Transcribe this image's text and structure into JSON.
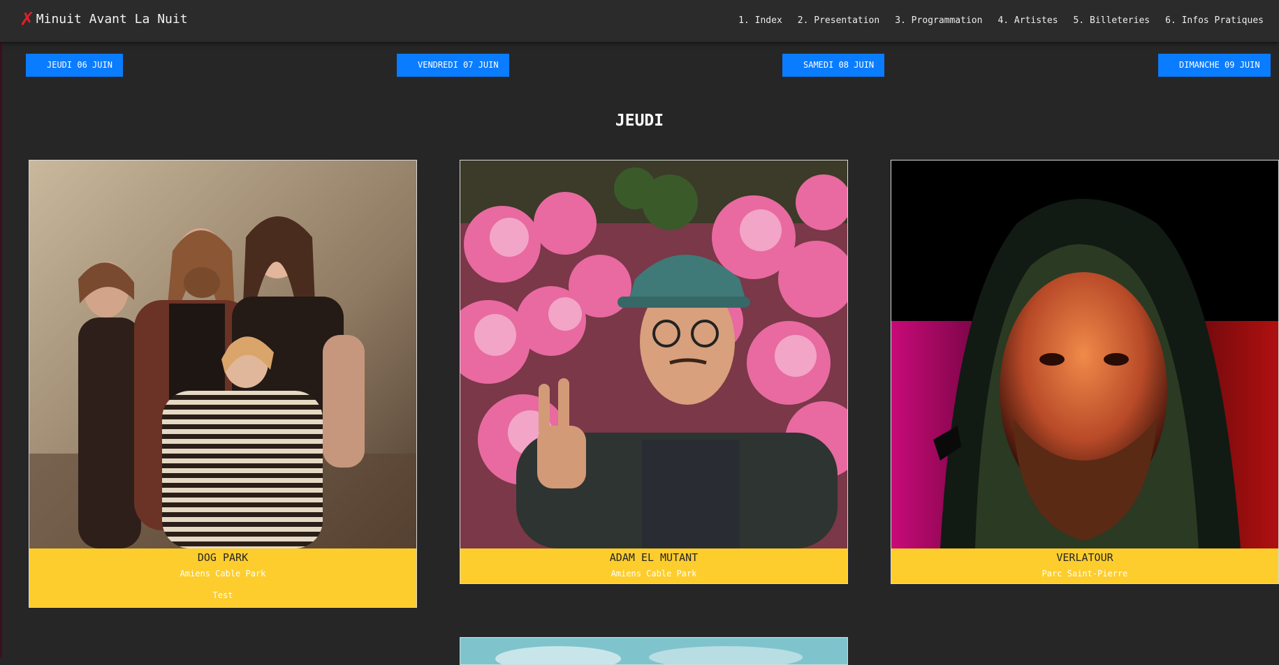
{
  "brand": {
    "logo_glyph": "✗",
    "title": "Minuit Avant La Nuit"
  },
  "nav": [
    "1. Index",
    "2. Presentation",
    "3. Programmation",
    "4. Artistes",
    "5. Billeteries",
    "6. Infos Pratiques"
  ],
  "days": [
    "JEUDI 06 JUIN",
    "VENDREDI 07 JUIN",
    "SAMEDI 08 JUIN",
    "DIMANCHE 09 JUIN"
  ],
  "section": {
    "title": "JEUDI"
  },
  "cards": [
    {
      "name": "DOG PARK",
      "venue": "Amiens Cable Park",
      "extra": "Test"
    },
    {
      "name": "ADAM EL MUTANT",
      "venue": "Amiens Cable Park"
    },
    {
      "name": "VERLATOUR",
      "venue": "Parc Saint-Pierre"
    }
  ],
  "colors": {
    "background": "#262626",
    "navbar": "#2b2b2b",
    "accent_blue": "#0a7cff",
    "card_yellow": "#fdcd2e",
    "logo_red": "#e0202a"
  }
}
